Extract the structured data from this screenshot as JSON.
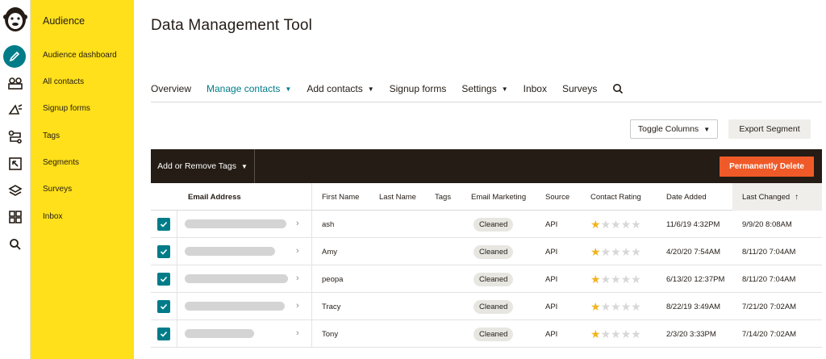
{
  "sidebar": {
    "title": "Audience",
    "items": [
      {
        "label": "Audience dashboard"
      },
      {
        "label": "All contacts"
      },
      {
        "label": "Signup forms"
      },
      {
        "label": "Tags"
      },
      {
        "label": "Segments"
      },
      {
        "label": "Surveys"
      },
      {
        "label": "Inbox"
      }
    ]
  },
  "rail": {
    "icons": [
      "mailchimp-logo",
      "pencil-icon",
      "audience-icon",
      "campaigns-icon",
      "automations-icon",
      "website-icon",
      "content-icon",
      "integrations-icon",
      "search-icon"
    ]
  },
  "page": {
    "title": "Data Management Tool"
  },
  "nav": {
    "items": [
      {
        "label": "Overview"
      },
      {
        "label": "Manage contacts"
      },
      {
        "label": "Add contacts"
      },
      {
        "label": "Signup forms"
      },
      {
        "label": "Settings"
      },
      {
        "label": "Inbox"
      },
      {
        "label": "Surveys"
      }
    ],
    "active": "Manage contacts"
  },
  "actions": {
    "toggle_columns": "Toggle Columns",
    "export_segment": "Export Segment",
    "add_remove_tags": "Add or Remove Tags",
    "permanently_delete": "Permanently Delete"
  },
  "table": {
    "headers": {
      "email": "Email Address",
      "first_name": "First Name",
      "last_name": "Last Name",
      "tags": "Tags",
      "email_marketing": "Email Marketing",
      "source": "Source",
      "rating": "Contact Rating",
      "date_added": "Date Added",
      "last_changed": "Last Changed"
    },
    "sort_indicator": "↑",
    "rows": [
      {
        "first_name": "ash",
        "last_name": "",
        "tags": "",
        "status": "Cleaned",
        "source": "API",
        "rating": 1,
        "date_added": "11/6/19 4:32PM",
        "last_changed": "9/9/20 8:08AM"
      },
      {
        "first_name": "Amy",
        "last_name": "",
        "tags": "",
        "status": "Cleaned",
        "source": "API",
        "rating": 1,
        "date_added": "4/20/20 7:54AM",
        "last_changed": "8/11/20 7:04AM"
      },
      {
        "first_name": "peopa",
        "last_name": "",
        "tags": "",
        "status": "Cleaned",
        "source": "API",
        "rating": 1,
        "date_added": "6/13/20 12:37PM",
        "last_changed": "8/11/20 7:04AM"
      },
      {
        "first_name": "Tracy",
        "last_name": "",
        "tags": "",
        "status": "Cleaned",
        "source": "API",
        "rating": 1,
        "date_added": "8/22/19 3:49AM",
        "last_changed": "7/21/20 7:02AM"
      },
      {
        "first_name": "Tony",
        "last_name": "",
        "tags": "",
        "status": "Cleaned",
        "source": "API",
        "rating": 1,
        "date_added": "2/3/20 3:33PM",
        "last_changed": "7/14/20 7:02AM"
      }
    ]
  },
  "colors": {
    "sidebar_bg": "#ffe01b",
    "accent_teal": "#007c89",
    "toolbar_bg": "#241c15",
    "delete_orange": "#f05a28",
    "star_gold": "#f1b41e"
  }
}
